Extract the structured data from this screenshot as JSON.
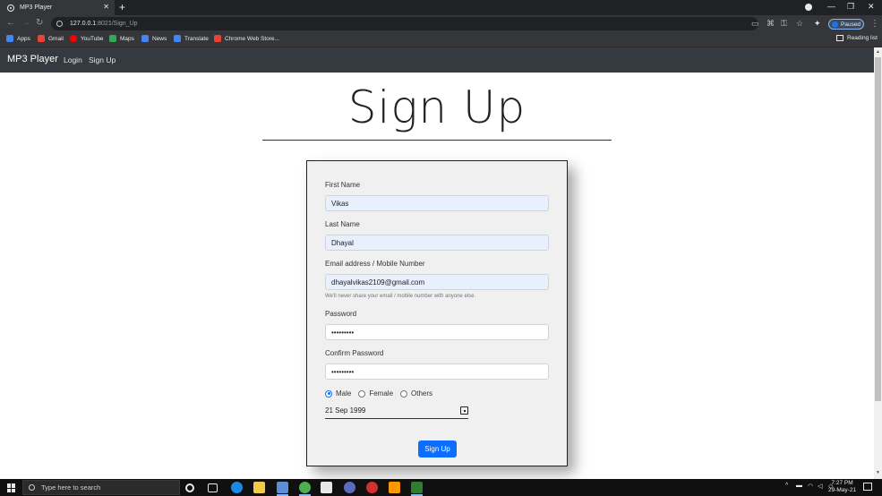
{
  "browser": {
    "tab_title": "MP3 Player",
    "url_host": "127.0.0.1",
    "url_path": ":8021/Sign_Up",
    "profile_status": "Paused",
    "bookmarks": [
      {
        "label": "Apps",
        "icon": "apps-grid-icon",
        "color": "#4285f4"
      },
      {
        "label": "Gmail",
        "icon": "gmail-icon",
        "color": "#ea4335"
      },
      {
        "label": "YouTube",
        "icon": "youtube-icon",
        "color": "#ff0000"
      },
      {
        "label": "Maps",
        "icon": "maps-icon",
        "color": "#34a853"
      },
      {
        "label": "News",
        "icon": "news-icon",
        "color": "#4285f4"
      },
      {
        "label": "Translate",
        "icon": "translate-icon",
        "color": "#4285f4"
      },
      {
        "label": "Chrome Web Store...",
        "icon": "web-store-icon",
        "color": "#ea4335"
      }
    ],
    "reading_list": "Reading list"
  },
  "navbar": {
    "brand": "MP3 Player",
    "links": [
      "Login",
      "Sign Up"
    ]
  },
  "page": {
    "heading": "Sign Up"
  },
  "form": {
    "first_name_label": "First Name",
    "first_name_value": "Vikas",
    "last_name_label": "Last Name",
    "last_name_value": "Dhayal",
    "email_label": "Email address / Mobile Number",
    "email_value": "dhayalvikas2109@gmail.com",
    "email_help": "We'll never share your email / mobile number with anyone else.",
    "password_label": "Password",
    "password_value": "•••••••••",
    "confirm_label": "Confirm Password",
    "confirm_value": "•••••••••",
    "gender_options": [
      "Male",
      "Female",
      "Others"
    ],
    "gender_selected": "Male",
    "dob_value": "21 Sep 1999",
    "submit_label": "Sign Up",
    "accent_color": "#0d6efd"
  },
  "taskbar": {
    "search_placeholder": "Type here to search",
    "time": "7:27 PM",
    "date": "29-May-21"
  }
}
